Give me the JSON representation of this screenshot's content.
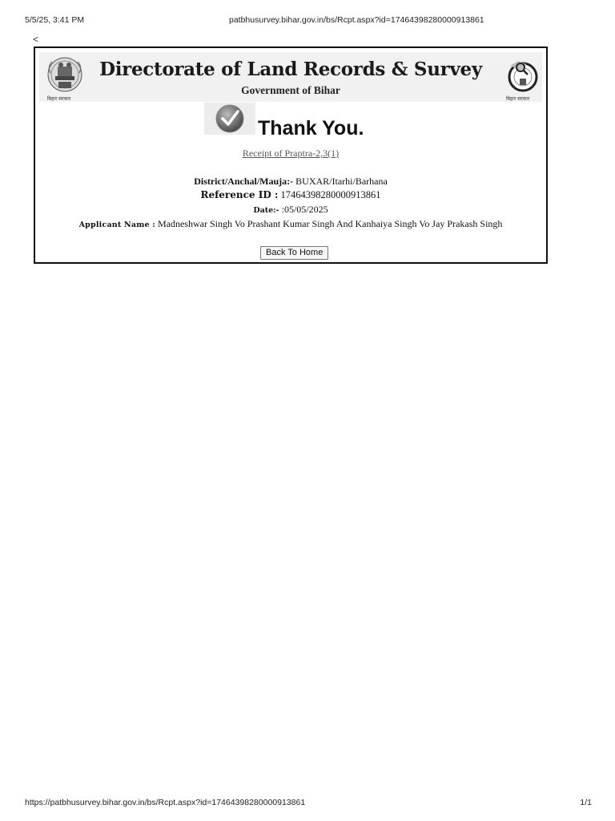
{
  "print_header": {
    "datetime": "5/5/25, 3:41 PM",
    "url": "patbhusurvey.bihar.gov.in/bs/Rcpt.aspx?id=17464398280000913861"
  },
  "nav": {
    "back_symbol": "<"
  },
  "banner": {
    "title": "Directorate of Land Records & Survey",
    "subtitle": "Government of Bihar",
    "left_logo_caption": "बिहार सरकार",
    "right_logo_caption": "बिहार सरकार",
    "left_logo_icon": "state-emblem-icon",
    "right_logo_icon": "survey-logo-icon"
  },
  "confirmation": {
    "icon": "checkmark-icon",
    "heading": "Thank You.",
    "receipt_link": "Receipt of Praptra-2,3(1)"
  },
  "details": {
    "district_label": "District/Anchal/Mauja:-",
    "district_value": " BUXAR/Itarhi/Barhana",
    "reference_label": "Reference ID :",
    "reference_value": " 17464398280000913861",
    "date_label": "Date:-",
    "date_value": " :05/05/2025",
    "applicant_label": "Applicant Name :",
    "applicant_value": " Madneshwar Singh Vo Prashant Kumar Singh And Kanhaiya Singh Vo Jay Prakash Singh"
  },
  "actions": {
    "back_home_label": "Back To Home"
  },
  "print_footer": {
    "url": "https://patbhusurvey.bihar.gov.in/bs/Rcpt.aspx?id=17464398280000913861",
    "page": "1/1"
  }
}
